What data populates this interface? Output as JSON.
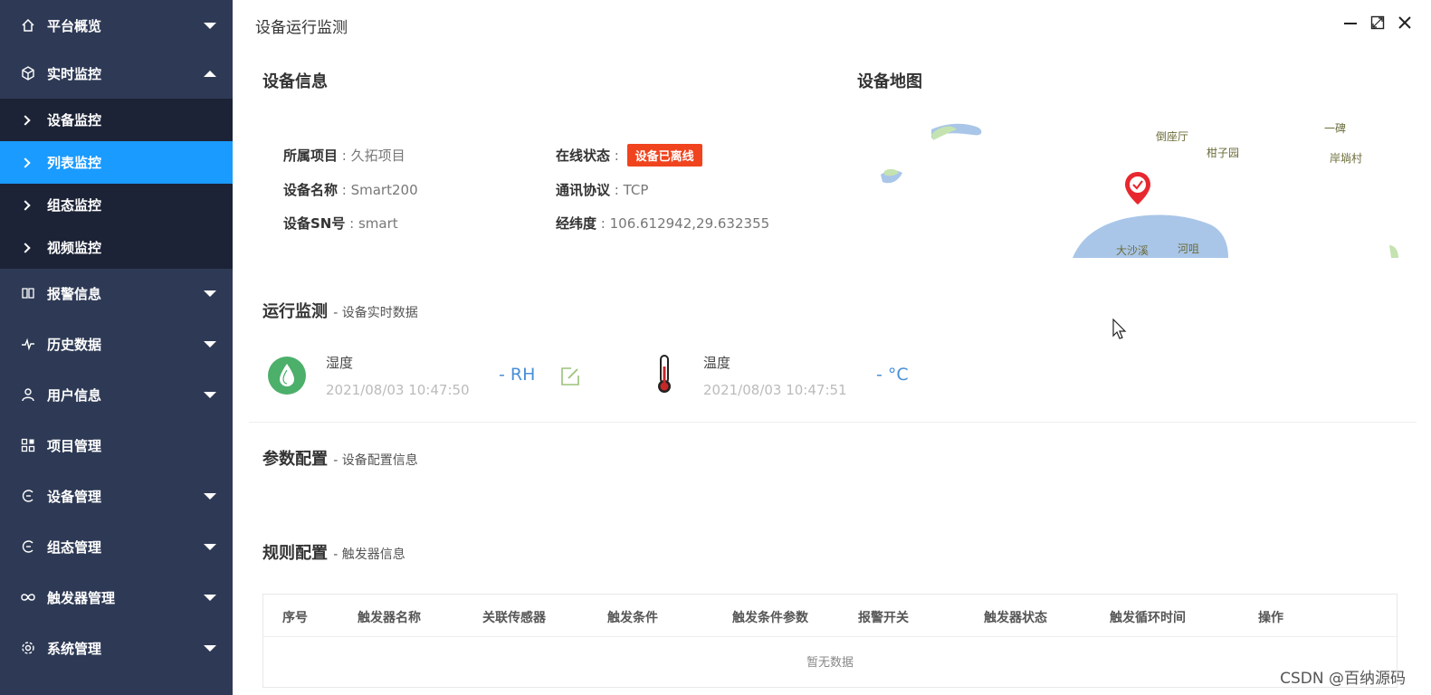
{
  "sidebar": {
    "platform": "平台概览",
    "realtime": "实时监控",
    "subs": [
      "设备监控",
      "列表监控",
      "组态监控",
      "视频监控"
    ],
    "alarm": "报警信息",
    "history": "历史数据",
    "user": "用户信息",
    "project": "项目管理",
    "device": "设备管理",
    "scada": "组态管理",
    "trigger": "触发器管理",
    "system": "系统管理"
  },
  "panel": {
    "title": "设备运行监测"
  },
  "device_info": {
    "title": "设备信息",
    "project_label": "所属项目",
    "project_value": "久拓项目",
    "name_label": "设备名称",
    "name_value": "Smart200",
    "sn_label": "设备SN号",
    "sn_value": "smart",
    "status_label": "在线状态",
    "status_value": "设备已离线",
    "protocol_label": "通讯协议",
    "protocol_value": "TCP",
    "coord_label": "经纬度",
    "coord_value": "106.612942,29.632355",
    "status_color": "#f0441e"
  },
  "map": {
    "title": "设备地图",
    "labels": [
      "倒座厅",
      "柑子园",
      "一碑",
      "岸埫村",
      "大沙溪",
      "河咀"
    ]
  },
  "monitor": {
    "title": "运行监测",
    "subtitle": "- 设备实时数据",
    "sensors": [
      {
        "name": "湿度",
        "time": "2021/08/03 10:47:50",
        "value": "- RH",
        "icon": "water-drop-icon"
      },
      {
        "name": "温度",
        "time": "2021/08/03 10:47:51",
        "value": "- °C",
        "icon": "thermometer-icon"
      }
    ]
  },
  "params": {
    "title": "参数配置",
    "subtitle": "- 设备配置信息"
  },
  "rules": {
    "title": "规则配置",
    "subtitle": "- 触发器信息",
    "columns": [
      "序号",
      "触发器名称",
      "关联传感器",
      "触发条件",
      "触发条件参数",
      "报警开关",
      "触发器状态",
      "触发循环时间",
      "操作"
    ],
    "empty_text": "暂无数据"
  },
  "watermark": "CSDN @百纳源码"
}
